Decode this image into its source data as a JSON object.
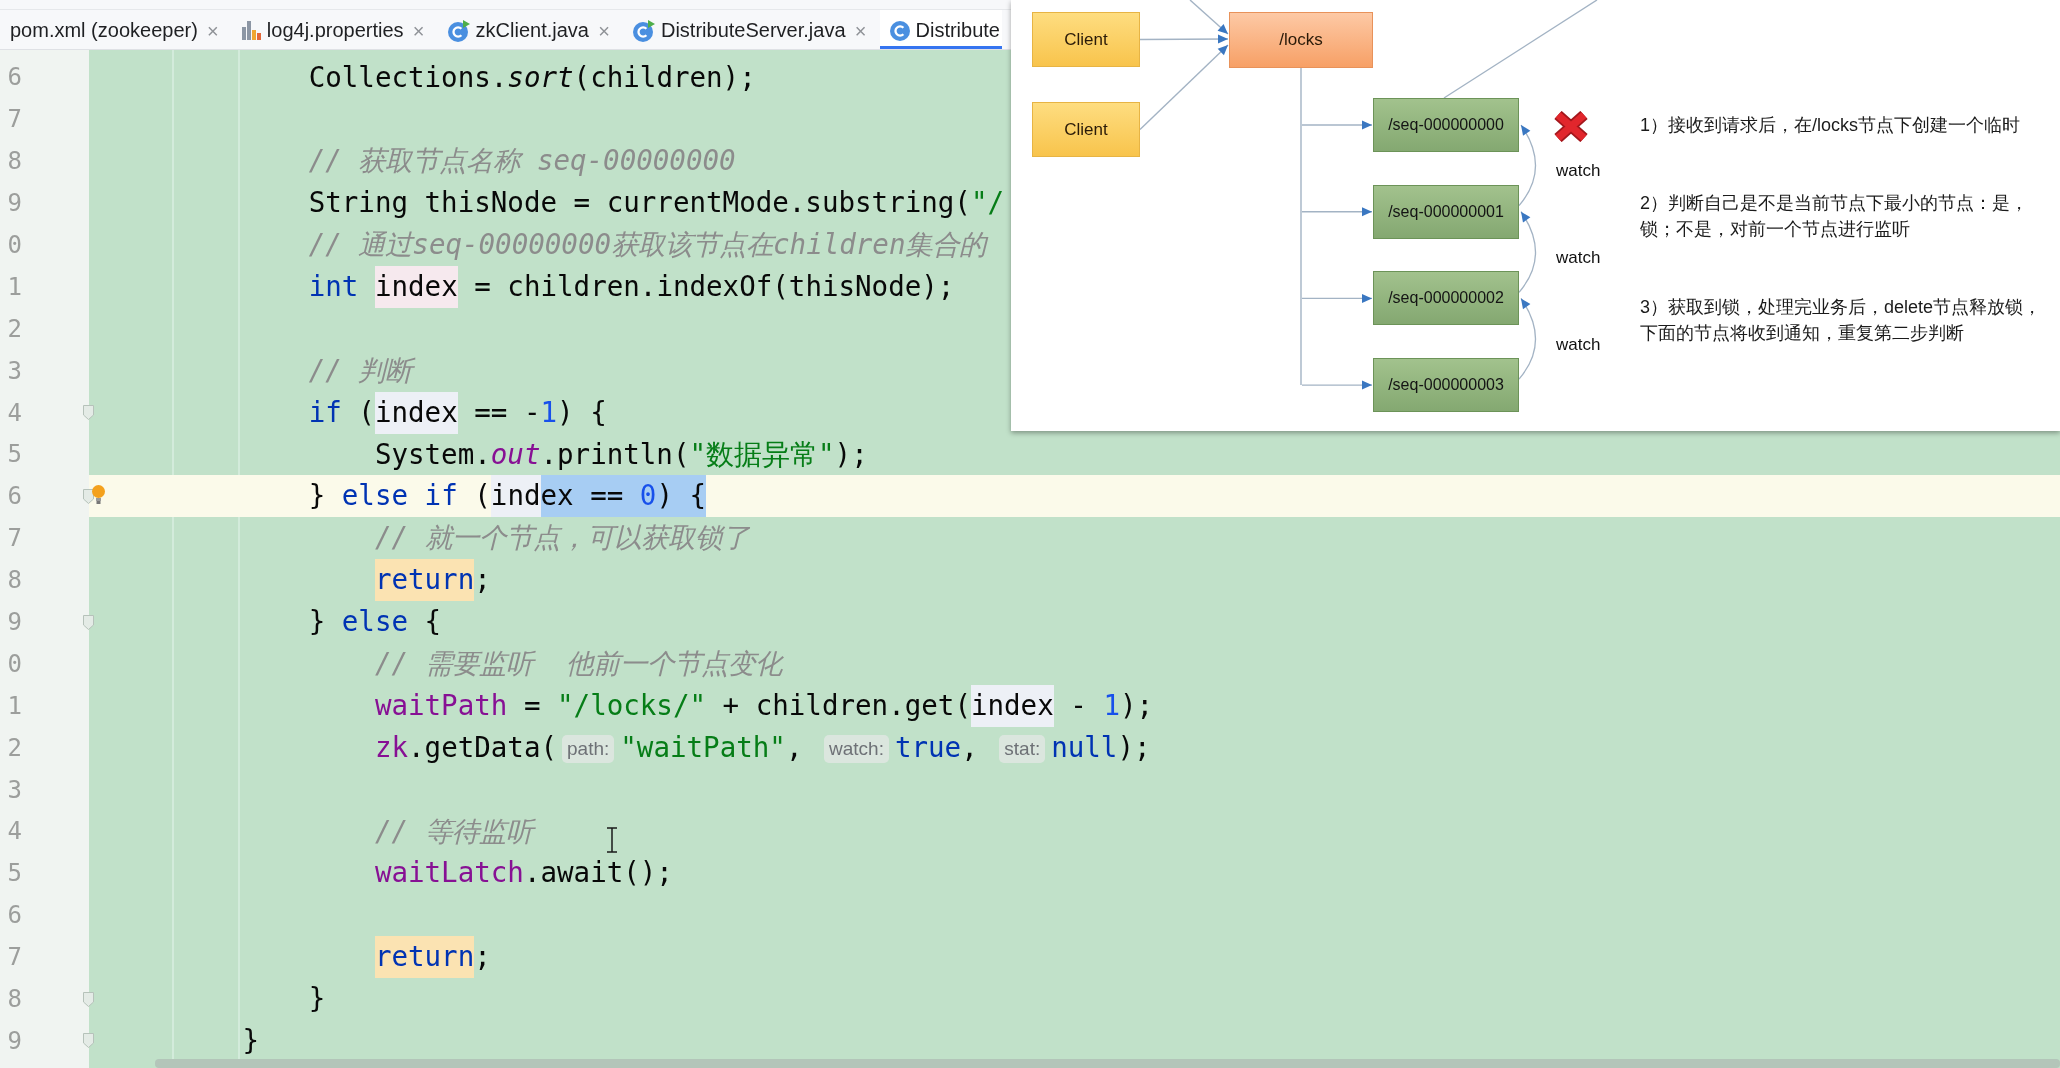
{
  "tab_bar": {
    "tabs": [
      {
        "label": "pom.xml (zookeeper)",
        "kind": "xml",
        "close": "×",
        "selected": false
      },
      {
        "label": "log4j.properties",
        "kind": "properties",
        "close": "×",
        "selected": false
      },
      {
        "label": "zkClient.java",
        "kind": "class_runnable",
        "close": "×",
        "selected": false
      },
      {
        "label": "DistributeServer.java",
        "kind": "class_runnable",
        "close": "×",
        "selected": false
      },
      {
        "label": "Distribute",
        "kind": "class",
        "selected": true
      }
    ]
  },
  "editor": {
    "lines": [
      {
        "children": [
          {
            "number": "6",
            "tokens": [
              {
                "text": "Collections.",
                "kind": "plain"
              },
              {
                "text": "sort",
                "kind": "static_call"
              },
              {
                "text": "(children);",
                "kind": "plain"
              }
            ],
            "current": false,
            "fold_marker": false,
            "bulb": false
          },
          {
            "number": "7",
            "current": false,
            "fold_marker": false,
            "bulb": false
          },
          {
            "number": "8",
            "tokens": [
              {
                "text": "// 获取节点名称 seq-00000000",
                "kind": "comment"
              }
            ],
            "current": false,
            "fold_marker": false,
            "bulb": false
          },
          {
            "number": "9",
            "tokens": [
              {
                "text": "String thisNode = currentMode.substring(",
                "kind": "plain"
              },
              {
                "text": "\"/",
                "kind": "string"
              }
            ],
            "current": false,
            "fold_marker": false,
            "bulb": false
          },
          {
            "number": "0",
            "tokens": [
              {
                "text": "// 通过seq-00000000获取该节点在children集合的",
                "kind": "comment"
              }
            ],
            "current": false,
            "fold_marker": false,
            "bulb": false
          },
          {
            "number": "1",
            "tokens": [
              {
                "text": "int ",
                "kind": "keyword"
              },
              {
                "text": "index",
                "kind": "variable_write"
              },
              {
                "text": " = children.indexOf(thisNode);",
                "kind": "plain"
              }
            ],
            "current": false,
            "fold_marker": false,
            "bulb": false
          },
          {
            "number": "2",
            "current": false,
            "fold_marker": false,
            "bulb": false
          },
          {
            "number": "3",
            "tokens": [
              {
                "text": "// 判断",
                "kind": "comment"
              }
            ],
            "current": false,
            "fold_marker": false,
            "bulb": false
          },
          {
            "number": "4",
            "tokens": [
              {
                "text": "if",
                "kind": "keyword"
              },
              {
                "text": " (",
                "kind": "plain"
              },
              {
                "text": "index",
                "kind": "variable_read"
              },
              {
                "text": " == -",
                "kind": "plain"
              },
              {
                "text": "1",
                "kind": "number"
              },
              {
                "text": ") {",
                "kind": "plain"
              }
            ],
            "current": false,
            "fold_marker": true,
            "bulb": false,
            "children": [
              {
                "number": "5",
                "tokens": [
                  {
                    "text": "System.",
                    "kind": "plain"
                  },
                  {
                    "text": "out",
                    "kind": "static_field"
                  },
                  {
                    "text": ".println(",
                    "kind": "plain"
                  },
                  {
                    "text": "\"数据异常\"",
                    "kind": "string"
                  },
                  {
                    "text": ");",
                    "kind": "plain"
                  }
                ],
                "current": false,
                "fold_marker": false,
                "bulb": false
              }
            ]
          },
          {
            "number": "6",
            "tokens": [
              {
                "text": "} ",
                "kind": "plain",
                "selected": false
              },
              {
                "text": "else",
                "kind": "keyword",
                "selected": false
              },
              {
                "text": " if",
                "kind": "keyword",
                "selected": false
              },
              {
                "text": " (",
                "kind": "plain",
                "selected": false
              },
              {
                "text": "ind",
                "kind": "variable_read",
                "selected": false
              },
              {
                "text": "ex",
                "kind": "variable_read",
                "selected": true
              },
              {
                "text": " == ",
                "kind": "plain",
                "selected": true
              },
              {
                "text": "0",
                "kind": "number",
                "selected": true
              },
              {
                "text": ") {",
                "kind": "plain",
                "selected": true
              }
            ],
            "current": true,
            "fold_marker": true,
            "bulb": true,
            "children": [
              {
                "number": "7",
                "tokens": [
                  {
                    "text": "// 就一个节点，可以获取锁了",
                    "kind": "comment"
                  }
                ],
                "current": false,
                "fold_marker": false,
                "bulb": false
              },
              {
                "number": "8",
                "tokens": [
                  {
                    "text": "return",
                    "kind": "exit_keyword"
                  },
                  {
                    "text": ";",
                    "kind": "plain"
                  }
                ],
                "current": false,
                "fold_marker": false,
                "bulb": false
              }
            ]
          },
          {
            "number": "9",
            "tokens": [
              {
                "text": "} ",
                "kind": "plain"
              },
              {
                "text": "else",
                "kind": "keyword"
              },
              {
                "text": " {",
                "kind": "plain"
              }
            ],
            "current": false,
            "fold_marker": true,
            "bulb": false,
            "children": [
              {
                "number": "0",
                "tokens": [
                  {
                    "text": "// 需要监听  他前一个节点变化",
                    "kind": "comment"
                  }
                ],
                "current": false,
                "fold_marker": false,
                "bulb": false
              },
              {
                "number": "1",
                "tokens": [
                  {
                    "text": "waitPath",
                    "kind": "field"
                  },
                  {
                    "text": " = ",
                    "kind": "plain"
                  },
                  {
                    "text": "\"/locks/\"",
                    "kind": "string"
                  },
                  {
                    "text": " + children.get(",
                    "kind": "plain"
                  },
                  {
                    "text": "index",
                    "kind": "variable_read"
                  },
                  {
                    "text": " - ",
                    "kind": "plain"
                  },
                  {
                    "text": "1",
                    "kind": "number"
                  },
                  {
                    "text": ");",
                    "kind": "plain"
                  }
                ],
                "current": false,
                "fold_marker": false,
                "bulb": false
              },
              {
                "number": "2",
                "tokens": [
                  {
                    "text": "zk",
                    "kind": "field"
                  },
                  {
                    "text": ".getData(",
                    "kind": "plain"
                  },
                  {
                    "text": "path:",
                    "kind": "hint"
                  },
                  {
                    "text": "\"waitPath\"",
                    "kind": "string"
                  },
                  {
                    "text": ", ",
                    "kind": "plain"
                  },
                  {
                    "text": "watch:",
                    "kind": "hint"
                  },
                  {
                    "text": "true",
                    "kind": "keyword"
                  },
                  {
                    "text": ", ",
                    "kind": "plain"
                  },
                  {
                    "text": "stat:",
                    "kind": "hint"
                  },
                  {
                    "text": "null",
                    "kind": "keyword"
                  },
                  {
                    "text": ");",
                    "kind": "plain"
                  }
                ],
                "current": false,
                "fold_marker": false,
                "bulb": false
              },
              {
                "number": "3",
                "current": false,
                "fold_marker": false,
                "bulb": false
              },
              {
                "number": "4",
                "tokens": [
                  {
                    "text": "// 等待监听",
                    "kind": "comment"
                  }
                ],
                "current": false,
                "fold_marker": false,
                "bulb": false
              },
              {
                "number": "5",
                "tokens": [
                  {
                    "text": "waitLatch",
                    "kind": "field"
                  },
                  {
                    "text": ".await();",
                    "kind": "plain"
                  }
                ],
                "current": false,
                "fold_marker": false,
                "bulb": false
              },
              {
                "number": "6",
                "current": false,
                "fold_marker": false,
                "bulb": false
              },
              {
                "number": "7",
                "tokens": [
                  {
                    "text": "return",
                    "kind": "exit_keyword"
                  },
                  {
                    "text": ";",
                    "kind": "plain"
                  }
                ],
                "current": false,
                "fold_marker": false,
                "bulb": false
              }
            ]
          },
          {
            "number": "8",
            "tokens": [
              {
                "text": "}",
                "kind": "plain"
              }
            ],
            "current": false,
            "fold_marker": true,
            "bulb": false
          }
        ]
      },
      {
        "number": "9",
        "tokens": [
          {
            "text": "}",
            "kind": "plain"
          }
        ],
        "current": false,
        "fold_marker": true,
        "bulb": false
      }
    ]
  },
  "diagram": {
    "clients": [
      {
        "label": "Client"
      },
      {
        "label": "Client"
      }
    ],
    "root": {
      "label": "/locks"
    },
    "sequence_nodes": [
      {
        "label": "/seq-000000000",
        "crossed": true
      },
      {
        "label": "/seq-000000001",
        "crossed": false
      },
      {
        "label": "/seq-000000002",
        "crossed": false
      },
      {
        "label": "/seq-000000003",
        "crossed": false
      }
    ],
    "watches": [
      {
        "label": "watch"
      },
      {
        "label": "watch"
      },
      {
        "label": "watch"
      }
    ],
    "steps": [
      {
        "lines": [
          "1）接收到请求后，在/locks节点下创建一个临时"
        ]
      },
      {
        "lines": [
          "2）判断自己是不是当前节点下最小的节点：是，",
          "锁；不是，对前一个节点进行监听"
        ]
      },
      {
        "lines": [
          "3）获取到锁，处理完业务后，delete节点释放锁，",
          "下面的节点将收到通知，重复第二步判断"
        ]
      }
    ]
  }
}
